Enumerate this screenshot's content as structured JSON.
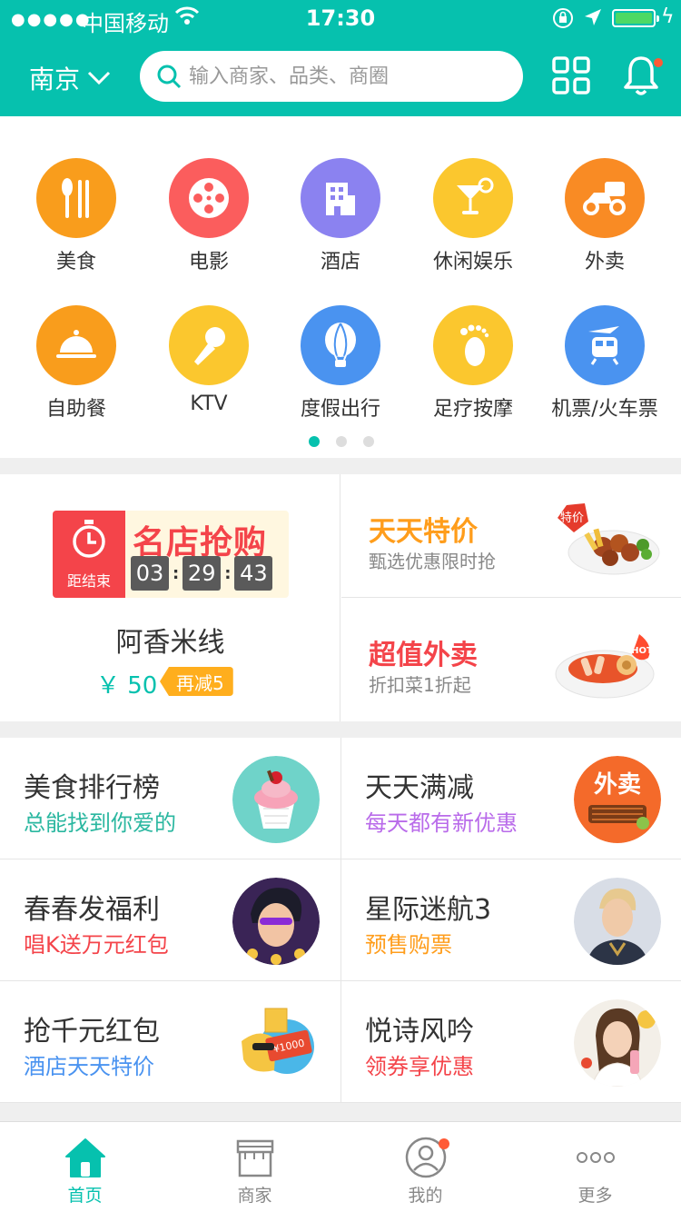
{
  "status_bar": {
    "carrier": "中国移动",
    "time": "17:30"
  },
  "header": {
    "city": "南京",
    "search_placeholder": "输入商家、品类、商圈"
  },
  "colors": {
    "primary": "#06c1ae",
    "accent_red": "#f4444a",
    "accent_orange": "#ff9d1b"
  },
  "categories": [
    {
      "label": "美食",
      "icon": "fork-knife-icon",
      "color": "#f99d1c"
    },
    {
      "label": "电影",
      "icon": "film-reel-icon",
      "color": "#fb5d5d"
    },
    {
      "label": "酒店",
      "icon": "building-icon",
      "color": "#8b82f0"
    },
    {
      "label": "休闲娱乐",
      "icon": "cocktail-icon",
      "color": "#fbc72e"
    },
    {
      "label": "外卖",
      "icon": "scooter-icon",
      "color": "#f98b24"
    },
    {
      "label": "自助餐",
      "icon": "food-cloche-icon",
      "color": "#f99d1c"
    },
    {
      "label": "KTV",
      "icon": "microphone-icon",
      "color": "#fbc72e"
    },
    {
      "label": "度假出行",
      "icon": "hot-air-balloon-icon",
      "color": "#4a93f0"
    },
    {
      "label": "足疗按摩",
      "icon": "foot-icon",
      "color": "#fbc72e"
    },
    {
      "label": "机票/火车票",
      "icon": "plane-train-icon",
      "color": "#4a93f0"
    }
  ],
  "flash_sale": {
    "badge_label": "距结束",
    "title": "名店抢购",
    "timer": [
      "03",
      "29",
      "43"
    ],
    "shop": "阿香米线",
    "price": "￥ 50",
    "tag": "再减5"
  },
  "deals": [
    {
      "title": "天天特价",
      "subtitle": "甄选优惠限时抢",
      "color": "#ff9d1b",
      "image": "meatball-dish-image",
      "sticker": "特价"
    },
    {
      "title": "超值外卖",
      "subtitle": "折扣菜1折起",
      "color": "#f4444a",
      "image": "rice-cake-dish-image",
      "sticker": "HOT"
    }
  ],
  "promos": [
    {
      "title": "美食排行榜",
      "subtitle": "总能找到你爱的",
      "color": "#2ab7a0",
      "image": "cupcake-image",
      "bg": "#6fd3c9"
    },
    {
      "title": "天天满减",
      "subtitle": "每天都有新优惠",
      "color": "#b96bea",
      "image": "takeout-image",
      "bg": "#f46a2a",
      "sticker": "外卖"
    },
    {
      "title": "春春发福利",
      "subtitle": "唱K送万元红包",
      "color": "#f4444a",
      "image": "singer-image",
      "bg": "#3a2456"
    },
    {
      "title": "星际迷航3",
      "subtitle": "预售购票",
      "color": "#ff9d1b",
      "image": "actor-image",
      "bg": "#d8dde6"
    },
    {
      "title": "抢千元红包",
      "subtitle": "酒店天天特价",
      "color": "#4a93f0",
      "image": "red-packet-image",
      "bg": "#ffffff",
      "sticker": "¥1000"
    },
    {
      "title": "悦诗风吟",
      "subtitle": "领券享优惠",
      "color": "#f4444a",
      "image": "model-image",
      "bg": "#f3efe8"
    }
  ],
  "tabs": [
    {
      "label": "首页",
      "icon": "home-icon",
      "active": true
    },
    {
      "label": "商家",
      "icon": "shop-icon",
      "active": false
    },
    {
      "label": "我的",
      "icon": "user-icon",
      "active": false
    },
    {
      "label": "更多",
      "icon": "more-icon",
      "active": false
    }
  ]
}
